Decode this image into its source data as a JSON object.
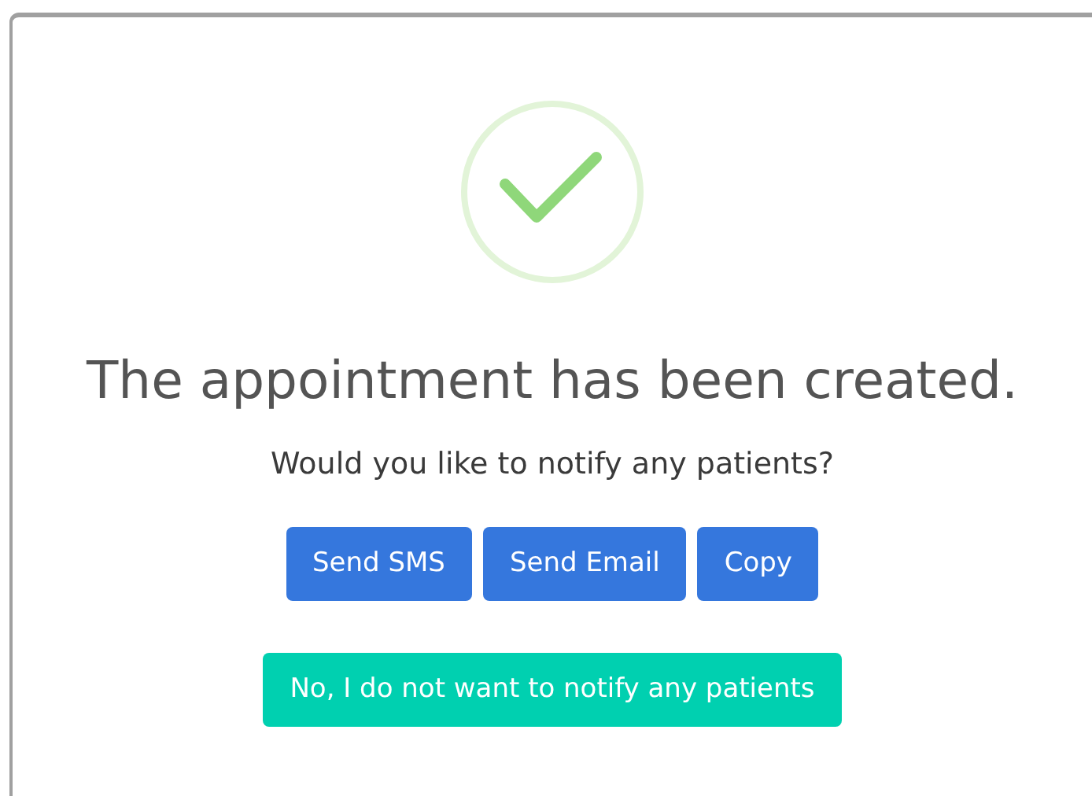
{
  "dialog": {
    "title": "The appointment has been created.",
    "question": "Would you like to notify any patients?",
    "actions": [
      {
        "label": "Send SMS"
      },
      {
        "label": "Send Email"
      },
      {
        "label": "Copy"
      }
    ],
    "decline_button": "No, I do not want to notify any patients"
  }
}
